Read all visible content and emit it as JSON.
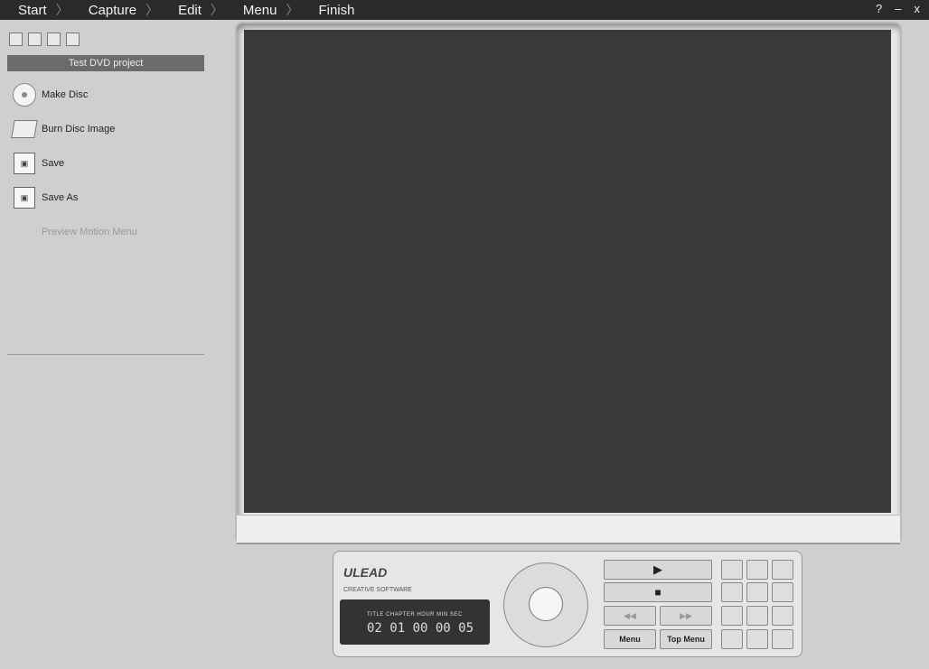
{
  "nav": {
    "steps": [
      "Start",
      "Capture",
      "Edit",
      "Menu",
      "Finish"
    ],
    "window_controls": [
      "?",
      "–",
      "x"
    ]
  },
  "project": {
    "name": "Test DVD project"
  },
  "actions": [
    {
      "label": "Make Disc"
    },
    {
      "label": "Burn Disc Image"
    },
    {
      "label": "Save"
    },
    {
      "label": "Save As"
    },
    {
      "label": "Preview Motion Menu"
    }
  ],
  "remote": {
    "brand": "ULEAD",
    "tagline": "CREATIVE SOFTWARE",
    "lcd_labels": "TITLE CHAPTER HOUR MIN SEC",
    "lcd_time": "02 01 00 00 05",
    "play_symbol": "▶",
    "stop_symbol": "■",
    "prev_symbol": "◀◀",
    "next_symbol": "▶▶",
    "menu_label": "Menu",
    "top_menu_label": "Top Menu"
  }
}
